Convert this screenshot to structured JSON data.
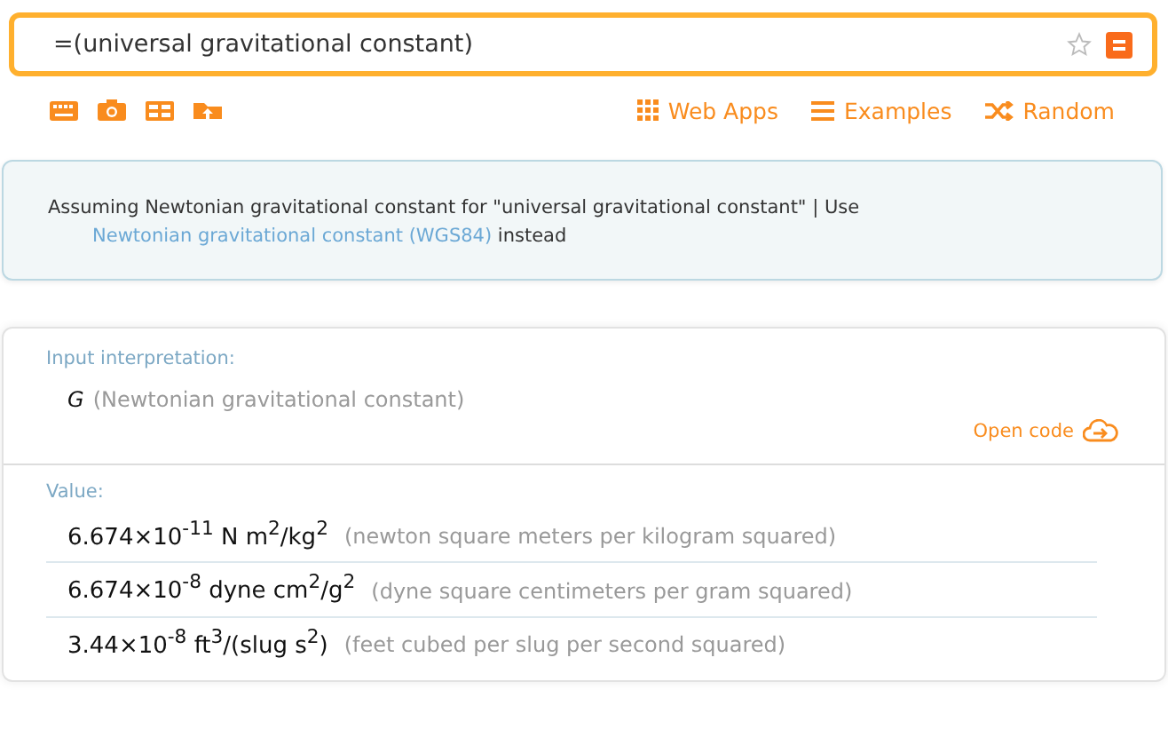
{
  "search": {
    "value": "=(universal gravitational constant)"
  },
  "toolbar": {
    "links": [
      {
        "label": "Web Apps",
        "kind": "grid"
      },
      {
        "label": "Examples",
        "kind": "list"
      },
      {
        "label": "Random",
        "kind": "shuffle"
      }
    ]
  },
  "assumption": {
    "prefix": "Assuming Newtonian gravitational constant for \"universal gravitational constant\" | Use",
    "link": "Newtonian gravitational constant (WGS84)",
    "suffix": "instead"
  },
  "pods": [
    {
      "title": "Input interpretation:",
      "symbol": "G",
      "description": "(Newtonian gravitational constant)",
      "action": "Open code"
    }
  ],
  "value_pod": {
    "title": "Value:",
    "rows": [
      {
        "value": "6.674×10$^{-11}$ N m$^{2}$/kg$^{2}$",
        "description": "(newton square meters per kilogram squared)"
      },
      {
        "value": "6.674×10$^{-8}$ dyne cm$^{2}$/g$^{2}$",
        "description": "(dyne square centimeters per gram squared)"
      },
      {
        "value": "3.44×10$^{-8}$ ft$^{3}$/(slug s$^{2}$)",
        "description": "(feet cubed per slug per second squared)"
      }
    ]
  }
}
